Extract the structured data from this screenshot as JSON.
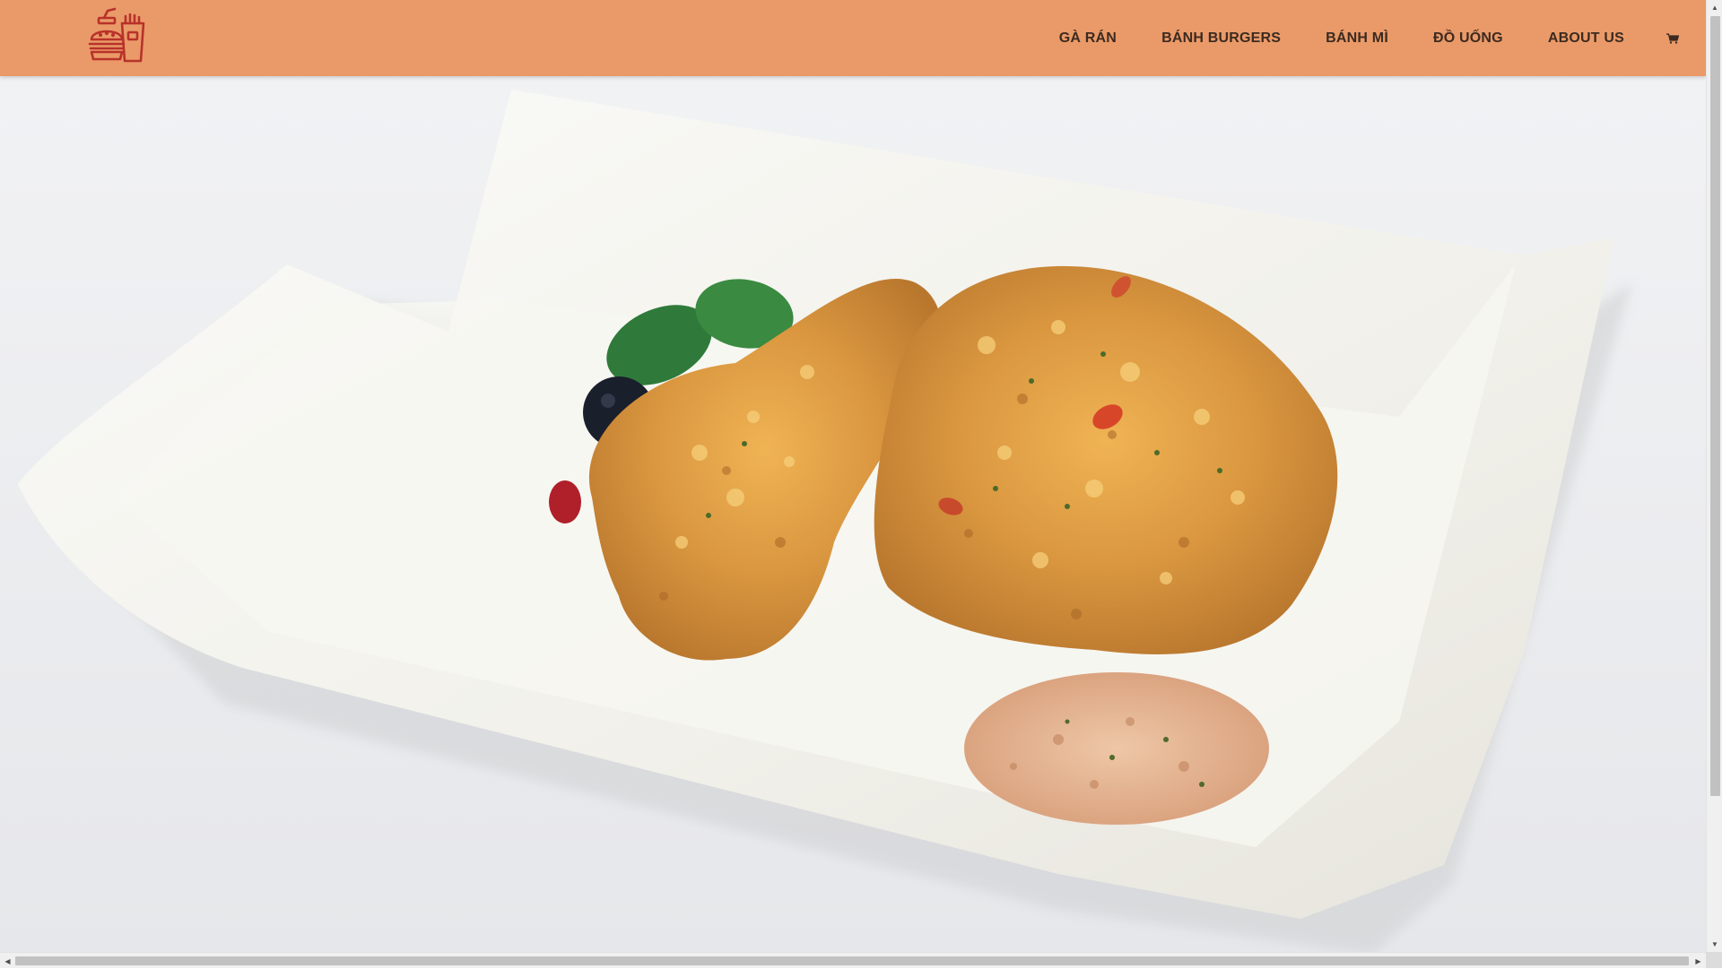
{
  "header": {
    "background_color": "#ea9a68",
    "logo_icon": "fast-food-logo-icon",
    "logo_color": "#c0392b",
    "nav_items": [
      {
        "label": "GÀ RÁN"
      },
      {
        "label": "BÁNH BURGERS"
      },
      {
        "label": "BÁNH MÌ"
      },
      {
        "label": "ĐỒ UỐNG"
      },
      {
        "label": "ABOUT US"
      }
    ],
    "cart_icon": "shopping-cart-icon"
  },
  "hero": {
    "image": "fried-chicken-on-white-plate"
  }
}
